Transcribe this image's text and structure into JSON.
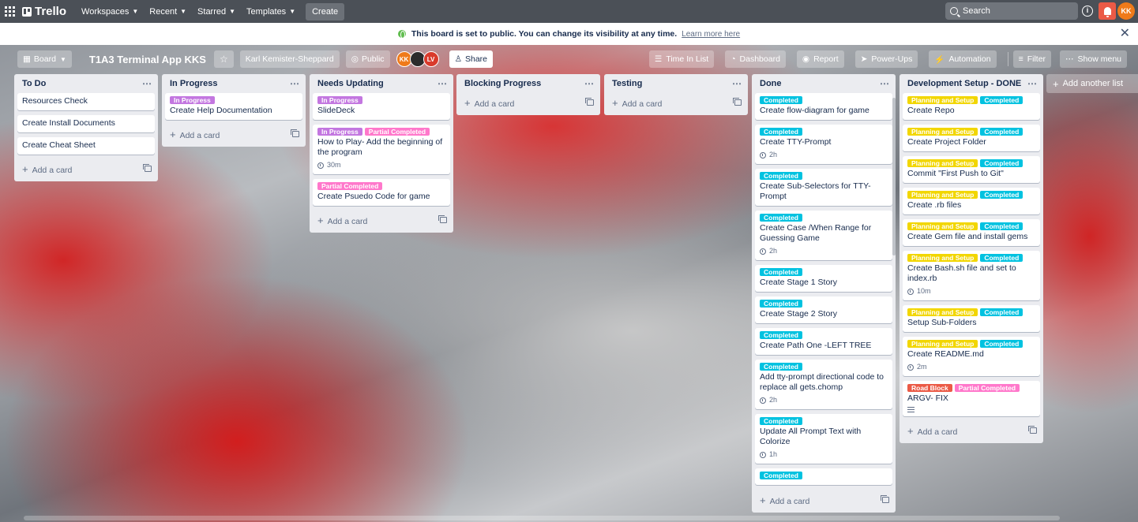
{
  "nav": {
    "brand": "Trello",
    "items": [
      {
        "label": "Workspaces"
      },
      {
        "label": "Recent"
      },
      {
        "label": "Starred"
      },
      {
        "label": "Templates"
      }
    ],
    "create_label": "Create",
    "search_placeholder": "Search",
    "avatar_initials": "KK"
  },
  "banner": {
    "text": "This board is set to public. You can change its visibility at any time.",
    "link": "Learn more here"
  },
  "board": {
    "view_label": "Board",
    "title": "T1A3 Terminal App KKS",
    "workspace": "Karl Kemister-Sheppard",
    "visibility": "Public",
    "members": [
      {
        "initials": "KK",
        "color": "#ef7a1a"
      },
      {
        "initials": "",
        "color": "#2b2b2b"
      },
      {
        "initials": "LV",
        "color": "#d93a2b"
      }
    ],
    "share_label": "Share",
    "right_buttons": [
      "Time In List",
      "Dashboard",
      "Report",
      "Power-Ups",
      "Automation",
      "Filter",
      "Show menu"
    ]
  },
  "label_colors": {
    "In Progress": "#c377e0",
    "Partial Completed": "#ff78cb",
    "Completed": "#00c2e0",
    "Planning and Setup": "#f2d600",
    "Road Block": "#eb5a46"
  },
  "add_card_label": "Add a card",
  "add_list_label": "Add another list",
  "lists": [
    {
      "title": "To Do",
      "cards": [
        {
          "title": "Resources Check",
          "labels": []
        },
        {
          "title": "Create Install Documents",
          "labels": []
        },
        {
          "title": "Create Cheat Sheet",
          "labels": []
        }
      ]
    },
    {
      "title": "In Progress",
      "cards": [
        {
          "title": "Create Help Documentation",
          "labels": [
            "In Progress"
          ]
        }
      ]
    },
    {
      "title": "Needs Updating",
      "cards": [
        {
          "title": "SlideDeck",
          "labels": [
            "In Progress"
          ]
        },
        {
          "title": "How to Play- Add the beginning of the program",
          "labels": [
            "In Progress",
            "Partial Completed"
          ],
          "time": "30m"
        },
        {
          "title": "Create Psuedo Code for game",
          "labels": [
            "Partial Completed"
          ]
        }
      ]
    },
    {
      "title": "Blocking Progress",
      "cards": []
    },
    {
      "title": "Testing",
      "cards": []
    },
    {
      "title": "Done",
      "cards": [
        {
          "title": "Create flow-diagram for game",
          "labels": [
            "Completed"
          ]
        },
        {
          "title": "Create TTY-Prompt",
          "labels": [
            "Completed"
          ],
          "time": "2h"
        },
        {
          "title": "Create Sub-Selectors for TTY-Prompt",
          "labels": [
            "Completed"
          ]
        },
        {
          "title": "Create Case /When Range for Guessing Game",
          "labels": [
            "Completed"
          ],
          "time": "2h"
        },
        {
          "title": "Create Stage 1 Story",
          "labels": [
            "Completed"
          ]
        },
        {
          "title": "Create Stage 2 Story",
          "labels": [
            "Completed"
          ]
        },
        {
          "title": "Create Path One -LEFT TREE",
          "labels": [
            "Completed"
          ]
        },
        {
          "title": "Add tty-prompt directional code to replace all gets.chomp",
          "labels": [
            "Completed"
          ],
          "time": "2h"
        },
        {
          "title": "Update All Prompt Text with Colorize",
          "labels": [
            "Completed"
          ],
          "time": "1h"
        },
        {
          "title": "",
          "labels": [
            "Completed"
          ]
        }
      ]
    },
    {
      "title": "Development Setup - DONE",
      "cards": [
        {
          "title": "Create Repo",
          "labels": [
            "Planning and Setup",
            "Completed"
          ]
        },
        {
          "title": "Create Project Folder",
          "labels": [
            "Planning and Setup",
            "Completed"
          ]
        },
        {
          "title": "Commit \"First Push to Git\"",
          "labels": [
            "Planning and Setup",
            "Completed"
          ]
        },
        {
          "title": "Create .rb files",
          "labels": [
            "Planning and Setup",
            "Completed"
          ]
        },
        {
          "title": "Create Gem file and install gems",
          "labels": [
            "Planning and Setup",
            "Completed"
          ]
        },
        {
          "title": "Create Bash.sh file and set to index.rb",
          "labels": [
            "Planning and Setup",
            "Completed"
          ],
          "time": "10m"
        },
        {
          "title": "Setup Sub-Folders",
          "labels": [
            "Planning and Setup",
            "Completed"
          ]
        },
        {
          "title": "Create README.md",
          "labels": [
            "Planning and Setup",
            "Completed"
          ],
          "time": "2m"
        },
        {
          "title": "ARGV- FIX",
          "labels": [
            "Road Block",
            "Partial Completed"
          ],
          "description": true
        }
      ]
    }
  ]
}
